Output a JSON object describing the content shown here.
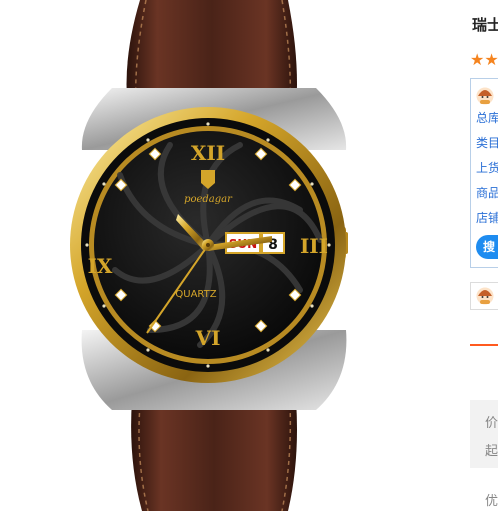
{
  "product": {
    "title": "瑞士",
    "rating_icons": [
      "star-icon",
      "star-icon"
    ],
    "image": {
      "brand_text": "poedagar",
      "dial_label": "QUARTZ",
      "day_window": "SUN",
      "date_window": "8",
      "roman_numerals": [
        "XII",
        "III",
        "VI",
        "IX"
      ]
    }
  },
  "seller": {
    "lines": [
      "总库",
      "类目",
      "上货",
      "商品",
      "店铺"
    ],
    "search_button": "搜"
  },
  "price": {
    "label": "价",
    "start_label": "起"
  },
  "promo": {
    "label": "优"
  },
  "colors": {
    "accent_orange": "#f5841f",
    "divider_orange": "#ff5a1f",
    "link_blue": "#2a6fd6",
    "button_blue": "#1e8cf0",
    "box_border": "#b8cfe8",
    "gold": "#d4a52a",
    "strap_brown": "#4a2318"
  }
}
